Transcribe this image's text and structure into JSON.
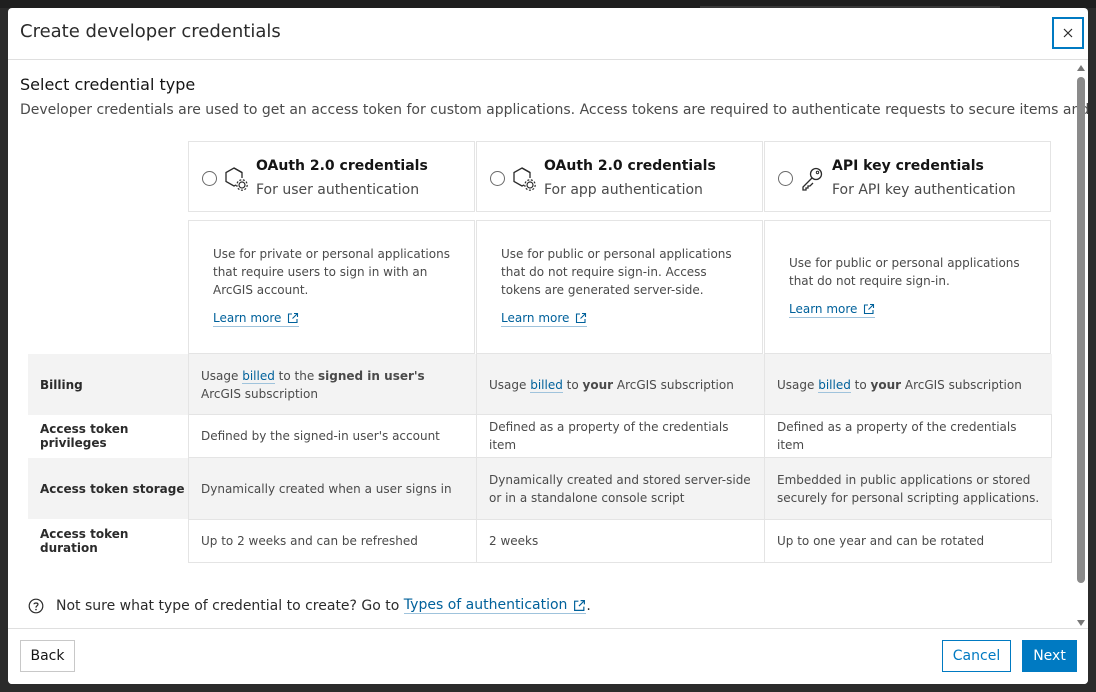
{
  "dialog": {
    "title": "Create developer credentials",
    "close_label": "×"
  },
  "section": {
    "title": "Select credential type",
    "description": "Developer credentials are used to get an access token for custom applications. Access tokens are required to authenticate requests to secure items and services."
  },
  "cards": [
    {
      "icon": "hexagon-gear-icon",
      "title": "OAuth 2.0 credentials",
      "subtitle": "For user authentication",
      "description": "Use for private or personal applications that require users to sign in with an ArcGIS account.",
      "learn_more": "Learn more"
    },
    {
      "icon": "hexagon-gear-icon",
      "title": "OAuth 2.0 credentials",
      "subtitle": "For app authentication",
      "description": "Use for public or personal applications that do not require sign-in. Access tokens are generated server-side.",
      "learn_more": "Learn more"
    },
    {
      "icon": "key-icon",
      "title": "API key credentials",
      "subtitle": "For API key authentication",
      "description": "Use for public or personal applications that do not require sign-in.",
      "learn_more": "Learn more"
    }
  ],
  "table": {
    "billing": {
      "label": "Billing",
      "values": [
        {
          "pre": "Usage ",
          "link": "billed",
          "mid": " to the ",
          "bold": "signed in user's",
          "post": " ArcGIS subscription"
        },
        {
          "pre": "Usage ",
          "link": "billed",
          "mid": " to ",
          "bold": "your",
          "post": " ArcGIS subscription"
        },
        {
          "pre": "Usage ",
          "link": "billed",
          "mid": " to ",
          "bold": "your",
          "post": " ArcGIS subscription"
        }
      ]
    },
    "privileges": {
      "label": "Access token privileges",
      "values": [
        "Defined by the signed-in user's account",
        "Defined as a property of the credentials item",
        "Defined as a property of the credentials item"
      ]
    },
    "storage": {
      "label": "Access token storage",
      "values": [
        "Dynamically created when a user signs in",
        "Dynamically created and stored server-side or in a standalone console script",
        "Embedded in public applications or stored securely for personal scripting applications."
      ]
    },
    "duration": {
      "label": "Access token duration",
      "values": [
        "Up to 2 weeks and can be refreshed",
        "2 weeks",
        "Up to one year and can be rotated"
      ]
    }
  },
  "help": {
    "text": "Not sure what type of credential to create? Go to",
    "link": "Types of authentication",
    "suffix": "."
  },
  "footer": {
    "back": "Back",
    "cancel": "Cancel",
    "next": "Next"
  },
  "colors": {
    "accent": "#007ac2",
    "link": "#00619b"
  }
}
